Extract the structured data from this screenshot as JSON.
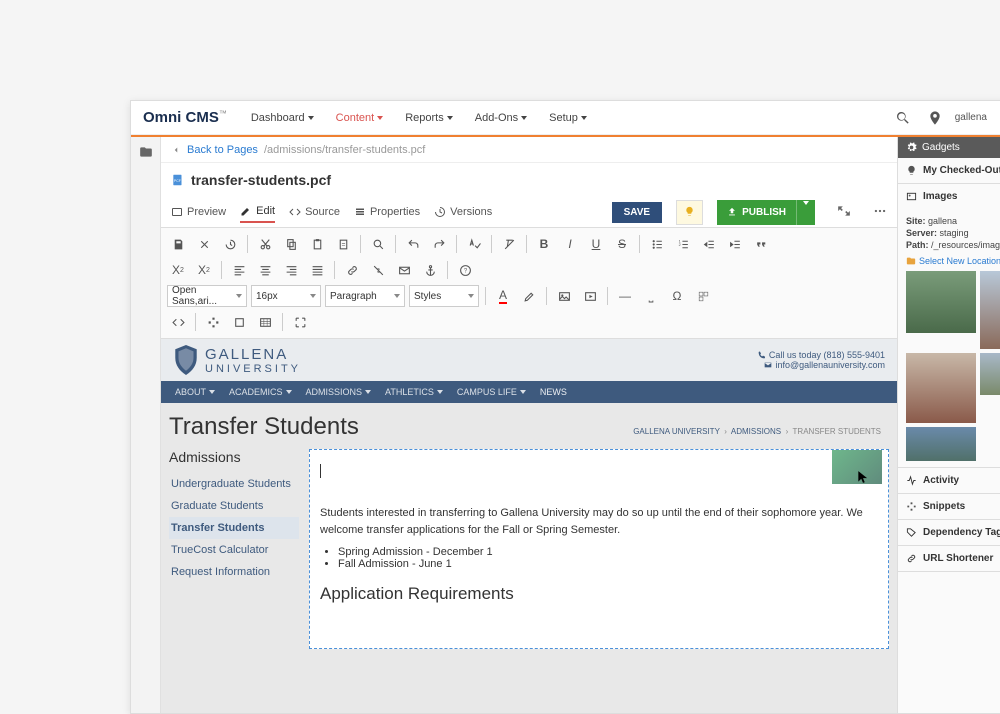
{
  "brand": "Omni CMS",
  "nav": {
    "dashboard": "Dashboard",
    "content": "Content",
    "reports": "Reports",
    "addons": "Add-Ons",
    "setup": "Setup"
  },
  "site_label": "gallena",
  "breadcrumb": {
    "back": "Back to Pages",
    "path": "/admissions/transfer-students.pcf"
  },
  "filename": "transfer-students.pcf",
  "tabs": {
    "preview": "Preview",
    "edit": "Edit",
    "source": "Source",
    "properties": "Properties",
    "versions": "Versions"
  },
  "buttons": {
    "save": "SAVE",
    "publish": "PUBLISH"
  },
  "toolbar_selects": {
    "font": "Open Sans,ari...",
    "size": "16px",
    "block": "Paragraph",
    "styles": "Styles"
  },
  "page": {
    "univ_line1": "GALLENA",
    "univ_line2": "UNIVERSITY",
    "phone": "Call us today (818) 555-9401",
    "email": "info@gallenauniversity.com",
    "navitems": [
      "ABOUT",
      "ACADEMICS",
      "ADMISSIONS",
      "ATHLETICS",
      "CAMPUS LIFE",
      "NEWS"
    ],
    "title": "Transfer Students",
    "crumb": [
      "GALLENA UNIVERSITY",
      "ADMISSIONS",
      "TRANSFER STUDENTS"
    ],
    "side_heading": "Admissions",
    "side": [
      "Undergraduate Students",
      "Graduate Students",
      "Transfer Students",
      "TrueCost Calculator",
      "Request Information"
    ],
    "side_active": 2,
    "paragraph": "Students interested in transferring to Gallena University may do so up until the end of their sophomore year. We welcome transfer applications for the Fall or Spring Semester.",
    "bullets": [
      "Spring Admission - December 1",
      "Fall Admission - June 1"
    ],
    "section": "Application Requirements"
  },
  "gadgets": {
    "title": "Gadgets",
    "panels": {
      "checked": "My Checked-Out Content",
      "images": "Images",
      "activity": "Activity",
      "snippets": "Snippets",
      "deptag": "Dependency Tag Info",
      "url": "URL Shortener"
    },
    "img_meta": {
      "site_l": "Site:",
      "site_v": "gallena",
      "server_l": "Server:",
      "server_v": "staging",
      "path_l": "Path:",
      "path_v": "/_resources/images/campus"
    },
    "select_loc": "Select New Location"
  }
}
